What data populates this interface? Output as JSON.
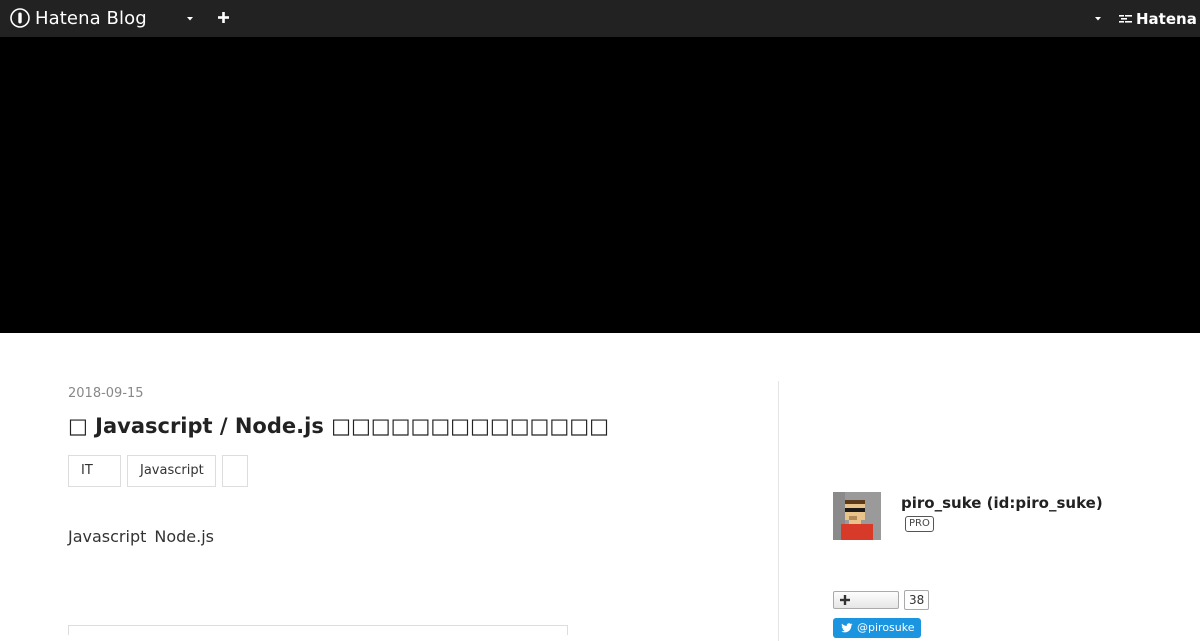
{
  "header": {
    "logo_text": "Hatena Blog",
    "hatena_label": "Hatena",
    "colors": {
      "background": "#222222",
      "text": "#ffffff"
    },
    "icons": [
      "hatena-blog-logo-icon",
      "chevron-down-icon",
      "plus-icon",
      "chevron-down-icon",
      "hatena-mark-icon"
    ]
  },
  "hero": {
    "background": "#000000"
  },
  "entry": {
    "date": "2018-09-15",
    "title": "□ Javascript / Node.js □□□□□□□□□□□□□□",
    "categories": [
      "IT",
      "Javascript",
      ""
    ],
    "body_words": [
      "Javascript",
      "Node.js"
    ]
  },
  "sidebar": {
    "author_name": "piro_suke (id:piro_suke)",
    "pro_badge": "PRO",
    "follow_count": "38",
    "twitter_handle": "@pirosuke",
    "colors": {
      "twitter": "#1b95e0"
    }
  }
}
